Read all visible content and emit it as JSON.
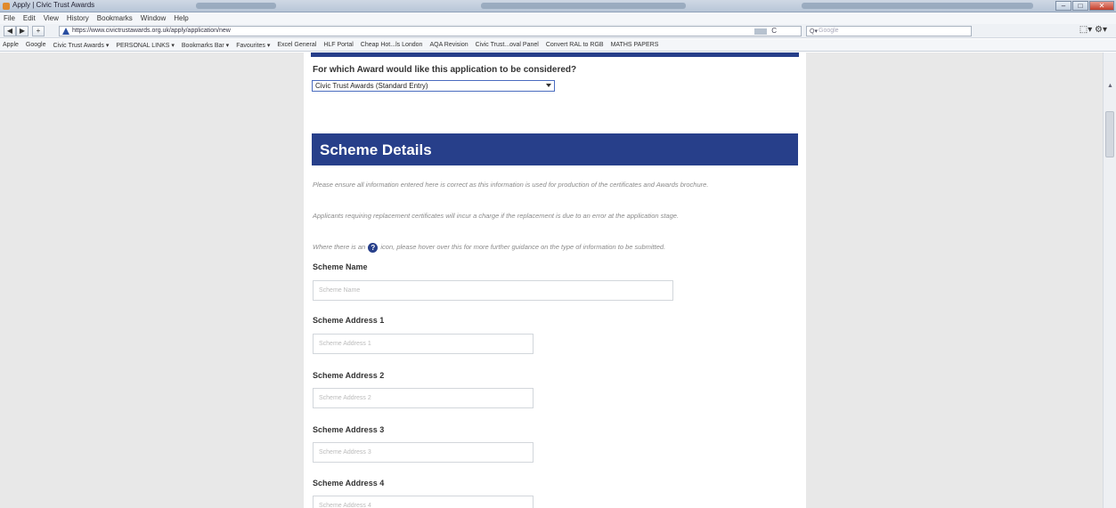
{
  "window": {
    "title": "Apply | Civic Trust Awards",
    "buttons": [
      "–",
      "□",
      "✕"
    ]
  },
  "menu": [
    "File",
    "Edit",
    "View",
    "History",
    "Bookmarks",
    "Window",
    "Help"
  ],
  "nav": {
    "back": "◀",
    "forward": "▶",
    "home": "+",
    "url": "https://www.civictrustawards.org.uk/apply/application/new",
    "reload": "C",
    "search_placeholder": "Google",
    "search_icon": "Q▾",
    "right_icons": "⬚▾ ⚙▾"
  },
  "bookmarks": [
    "Apple",
    "Google",
    "Civic Trust Awards ▾",
    "PERSONAL LINKS ▾",
    "Bookmarks Bar ▾",
    "Favourites ▾",
    "Excel General",
    "HLF Portal",
    "Cheap Hot...ls London",
    "AQA Revision",
    "Civic Trust...oval Panel",
    "Convert RAL to RGB",
    "MATHS PAPERS"
  ],
  "form": {
    "award_question": "For which Award would like this application to be considered?",
    "award_selected": "Civic Trust Awards (Standard Entry)",
    "section_title": "Scheme Details",
    "info_1": "Please ensure all information entered here is correct as this information is used for production of the certificates and Awards brochure.",
    "info_2": "Applicants requiring replacement certificates will incur a charge if the replacement is due to an error at the application stage.",
    "info_3_before": "Where there is an",
    "info_3_icon": "?",
    "info_3_after": "icon, please hover over this for more further guidance on the type of information to be submitted.",
    "fields": [
      {
        "label": "Scheme Name",
        "placeholder": "Scheme Name"
      },
      {
        "label": "Scheme Address 1",
        "placeholder": "Scheme Address 1"
      },
      {
        "label": "Scheme Address 2",
        "placeholder": "Scheme Address 2"
      },
      {
        "label": "Scheme Address 3",
        "placeholder": "Scheme Address 3"
      },
      {
        "label": "Scheme Address 4",
        "placeholder": "Scheme Address 4"
      }
    ]
  },
  "colors": {
    "brand_navy": "#273f8a",
    "side_gray": "#e8e8e8"
  }
}
